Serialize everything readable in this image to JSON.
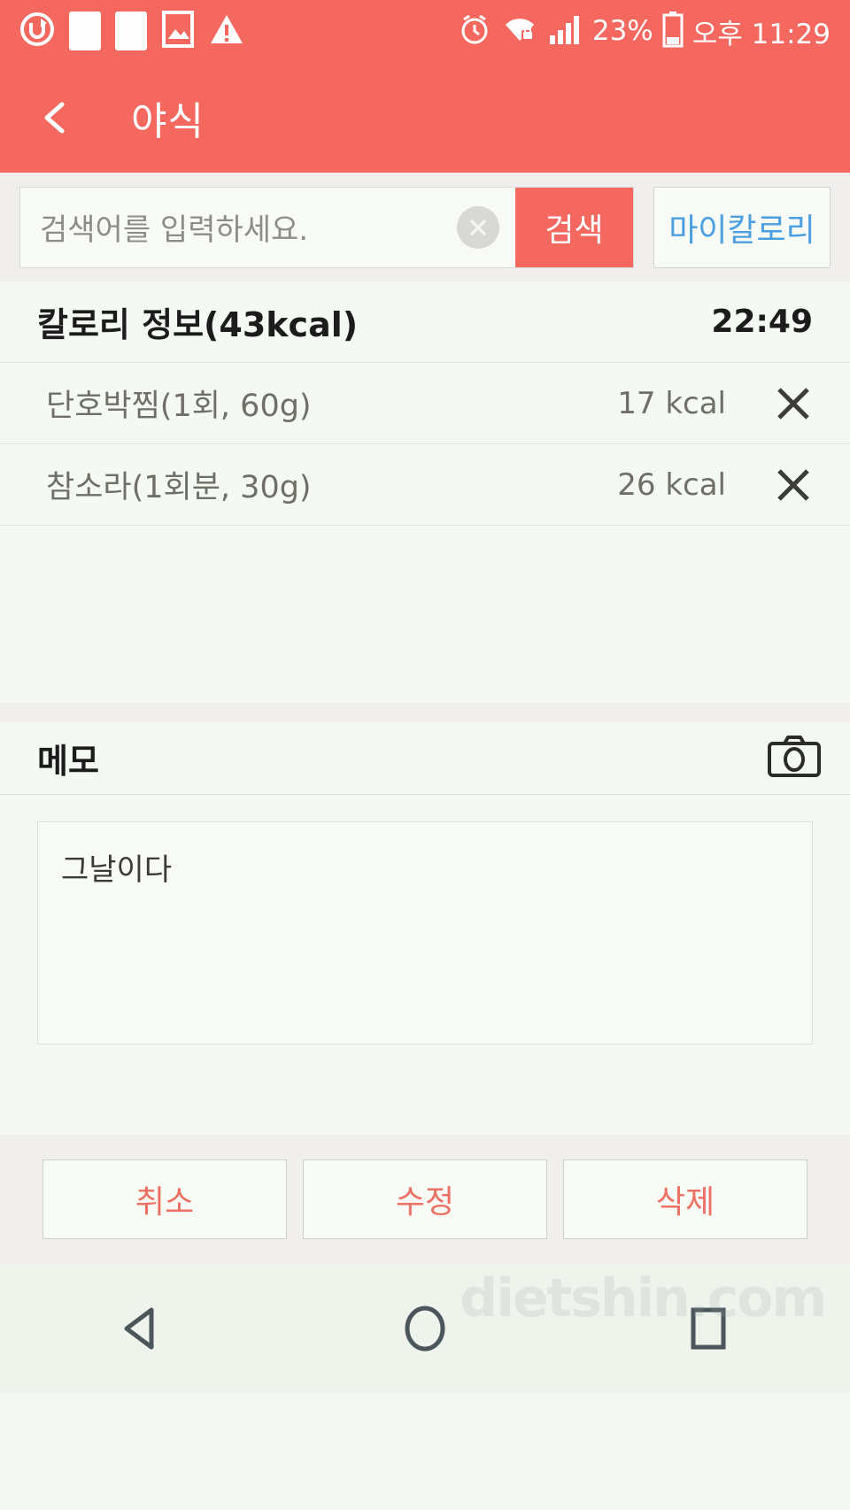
{
  "status_bar": {
    "time": "오후 11:29",
    "battery_percent": "23%",
    "icons": [
      "u-refresh-icon",
      "blank-square-icon",
      "blank-square-icon",
      "image-icon",
      "warning-icon",
      "alarm-icon",
      "wifi-secure-icon",
      "signal-icon",
      "battery-icon"
    ]
  },
  "app_bar": {
    "title": "야식",
    "back_icon": "back-chevron-icon"
  },
  "search": {
    "placeholder": "검색어를 입력하세요.",
    "value": "",
    "clear_icon": "clear-circle-icon",
    "search_label": "검색",
    "mycalorie_label": "마이칼로리"
  },
  "calorie_section": {
    "title": "칼로리 정보(43kcal)",
    "total_kcal": "43kcal",
    "time": "22:49",
    "items": [
      {
        "name": "단호박찜(1회, 60g)",
        "kcal": "17 kcal",
        "delete_icon": "close-x-icon"
      },
      {
        "name": "참소라(1회분, 30g)",
        "kcal": "26 kcal",
        "delete_icon": "close-x-icon"
      }
    ]
  },
  "memo": {
    "label": "메모",
    "camera_icon": "camera-icon",
    "text": "그날이다"
  },
  "actions": {
    "cancel_label": "취소",
    "edit_label": "수정",
    "delete_label": "삭제"
  },
  "nav_bar": {
    "back_icon": "nav-back-triangle-icon",
    "home_icon": "nav-home-circle-icon",
    "recents_icon": "nav-recents-square-icon",
    "watermark": "dietshin.com"
  },
  "colors": {
    "accent": "#f4685f",
    "link_blue": "#4a9fe0",
    "action_text": "#ec7164",
    "page_bg": "#f5f9f3"
  }
}
